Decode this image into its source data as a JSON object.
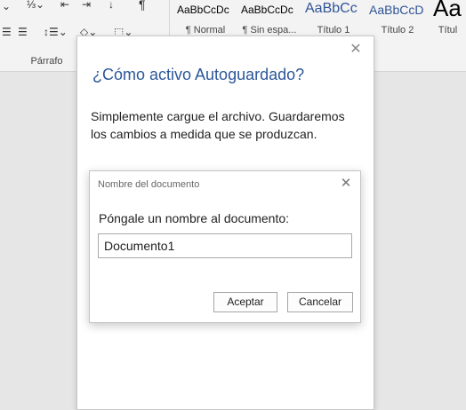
{
  "ribbon": {
    "paragraph_group_label": "Párrafo",
    "styles": [
      {
        "sample": "AaBbCcDc",
        "name": "¶ Normal",
        "sample_color": "#222222"
      },
      {
        "sample": "AaBbCcDc",
        "name": "¶ Sin espa...",
        "sample_color": "#222222"
      },
      {
        "sample": "AaBbCc",
        "name": "Título 1",
        "sample_color": "#2f5496"
      },
      {
        "sample": "AaBbCcD",
        "name": "Título 2",
        "sample_color": "#2f5496"
      },
      {
        "sample": "Aa",
        "name": "Títul",
        "sample_color": "#222222"
      }
    ]
  },
  "autosave_panel": {
    "title": "¿Cómo activo Autoguardado?",
    "body": "Simplemente cargue el archivo. Guardaremos los cambios a medida que se produzcan.",
    "close_glyph": "✕"
  },
  "rename_dialog": {
    "title": "Nombre del documento",
    "prompt": "Póngale un nombre al documento:",
    "input_value": "Documento1",
    "accept_label": "Aceptar",
    "cancel_label": "Cancelar",
    "close_glyph": "✕"
  },
  "colors": {
    "accent_title": "#2b579a",
    "ribbon_bg": "#f3f3f3",
    "doc_bg": "#e6e6e6"
  }
}
